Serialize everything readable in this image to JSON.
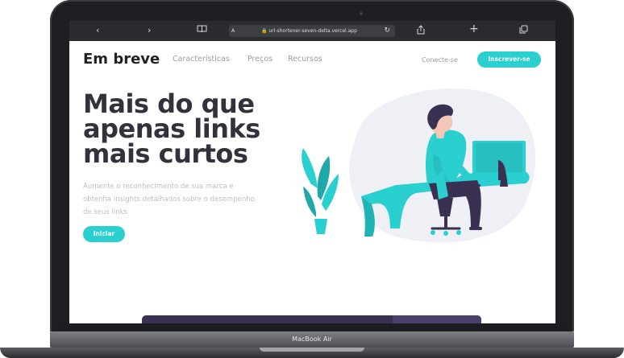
{
  "browser": {
    "url": "url-shortener-seven-delta.vercel.app",
    "text_size_label": "A",
    "icons": [
      "chevron-left-icon",
      "chevron-right-icon",
      "book-icon",
      "lock-icon",
      "reload-icon",
      "share-icon",
      "plus-icon",
      "tabs-icon"
    ]
  },
  "nav": {
    "logo": "Em breve",
    "links": [
      "Características",
      "Preços",
      "Recursos"
    ],
    "login": "Conecte-se",
    "signup": "Inscrever-se"
  },
  "hero": {
    "title_lines": [
      "Mais do que",
      "apenas links",
      "mais curtos"
    ],
    "subtitle_lines": [
      "Aumente o reconhecimento de sua marca e",
      "obtenha insights detalhados sobre o desempenho",
      "de seus links"
    ],
    "cta": "Iniciar"
  },
  "device": {
    "label": "MacBook Air"
  },
  "colors": {
    "accent": "#2acfcf",
    "dark": "#232127",
    "muted": "#9e9aa7",
    "strip": "#3a3052"
  }
}
